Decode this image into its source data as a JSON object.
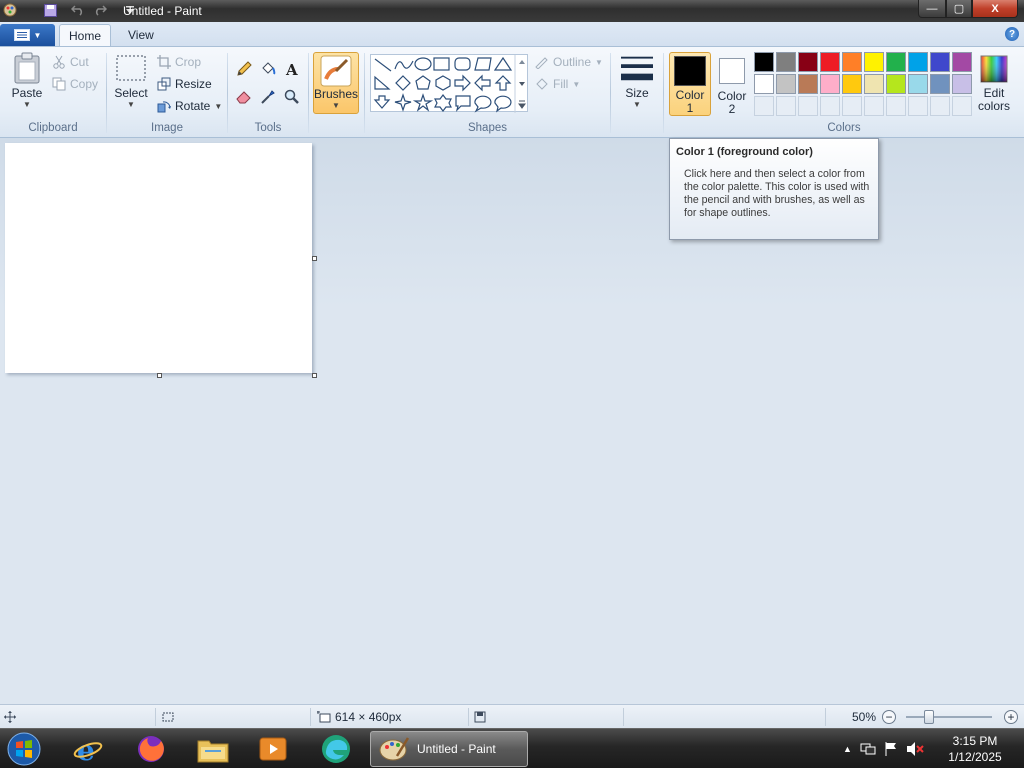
{
  "window": {
    "title": "Untitled - Paint",
    "min_glyph": "—",
    "max_glyph": "▢",
    "close_glyph": "X"
  },
  "tabs": {
    "home": "Home",
    "view": "View"
  },
  "help_glyph": "?",
  "ribbon": {
    "clipboard": {
      "label": "Clipboard",
      "paste": "Paste",
      "cut": "Cut",
      "copy": "Copy"
    },
    "image": {
      "label": "Image",
      "select": "Select",
      "crop": "Crop",
      "resize": "Resize",
      "rotate": "Rotate"
    },
    "tools": {
      "label": "Tools"
    },
    "brushes": "Brushes",
    "shapes": {
      "label": "Shapes",
      "outline": "Outline",
      "fill": "Fill"
    },
    "size": "Size",
    "colors": {
      "label": "Colors",
      "color1_line1": "Color",
      "color1_line2": "1",
      "color2_line1": "Color",
      "color2_line2": "2",
      "edit_line1": "Edit",
      "edit_line2": "colors",
      "color1_value": "#000000",
      "color2_value": "#ffffff",
      "palette_row1": [
        "#000000",
        "#7f7f7f",
        "#880015",
        "#ed1c24",
        "#ff7f27",
        "#fff200",
        "#22b14c",
        "#00a2e8",
        "#3f48cc",
        "#a349a4"
      ],
      "palette_row2": [
        "#ffffff",
        "#c3c3c3",
        "#b97a57",
        "#ffaec9",
        "#ffc90e",
        "#efe4b0",
        "#b5e61d",
        "#99d9ea",
        "#7092be",
        "#c8bfe7"
      ]
    }
  },
  "tooltip": {
    "title": "Color 1 (foreground color)",
    "body": "Click here and then select a color from the color palette. This color is used with the pencil  and with brushes, as well as for shape outlines."
  },
  "status": {
    "canvas_size": "614 × 460px",
    "zoom": "50%"
  },
  "taskbar": {
    "active_window": "Untitled - Paint",
    "time": "3:15 PM",
    "date": "1/12/2025"
  }
}
